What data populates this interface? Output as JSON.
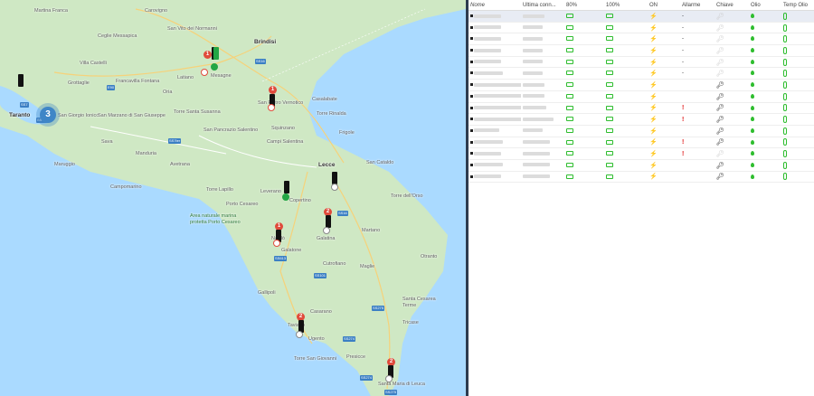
{
  "map": {
    "labels": [
      {
        "text": "Martina Franca",
        "type": ""
      },
      {
        "text": "Carovigno",
        "type": ""
      },
      {
        "text": "Brindisi",
        "type": "city"
      },
      {
        "text": "Ceglie Messapica",
        "type": ""
      },
      {
        "text": "San Vito dei Normanni",
        "type": ""
      },
      {
        "text": "Mesagne",
        "type": ""
      },
      {
        "text": "Villa Castelli",
        "type": ""
      },
      {
        "text": "Grottaglie",
        "type": ""
      },
      {
        "text": "Francavilla Fontana",
        "type": ""
      },
      {
        "text": "Latiano",
        "type": ""
      },
      {
        "text": "Oria",
        "type": ""
      },
      {
        "text": "Taranto",
        "type": "city"
      },
      {
        "text": "San Giorgio Ionico",
        "type": ""
      },
      {
        "text": "San Marzano di San Giuseppe",
        "type": ""
      },
      {
        "text": "Torre Santa Susanna",
        "type": ""
      },
      {
        "text": "San Pietro Vernotico",
        "type": ""
      },
      {
        "text": "Casalabate",
        "type": ""
      },
      {
        "text": "Torre Rinalda",
        "type": ""
      },
      {
        "text": "Sava",
        "type": ""
      },
      {
        "text": "Manduria",
        "type": ""
      },
      {
        "text": "San Pancrazio Salentino",
        "type": ""
      },
      {
        "text": "Squinzano",
        "type": ""
      },
      {
        "text": "Campi Salentina",
        "type": ""
      },
      {
        "text": "Frigole",
        "type": ""
      },
      {
        "text": "Maruggio",
        "type": ""
      },
      {
        "text": "Avetrana",
        "type": ""
      },
      {
        "text": "Lecce",
        "type": "city"
      },
      {
        "text": "San Cataldo",
        "type": ""
      },
      {
        "text": "Campomarino",
        "type": ""
      },
      {
        "text": "Torre Lapillo",
        "type": ""
      },
      {
        "text": "Leverano",
        "type": ""
      },
      {
        "text": "Copertino",
        "type": ""
      },
      {
        "text": "Torre dell'Orso",
        "type": ""
      },
      {
        "text": "Porto Cesareo",
        "type": ""
      },
      {
        "text": "Area naturale marina protetta Porto Cesareo",
        "type": "park"
      },
      {
        "text": "Nardò",
        "type": ""
      },
      {
        "text": "Galatina",
        "type": ""
      },
      {
        "text": "Martano",
        "type": ""
      },
      {
        "text": "Otranto",
        "type": ""
      },
      {
        "text": "Galatone",
        "type": ""
      },
      {
        "text": "Cutrofiano",
        "type": ""
      },
      {
        "text": "Maglie",
        "type": ""
      },
      {
        "text": "Gallipoli",
        "type": ""
      },
      {
        "text": "Santa Cesarea Terme",
        "type": ""
      },
      {
        "text": "Casarano",
        "type": ""
      },
      {
        "text": "Taviano",
        "type": ""
      },
      {
        "text": "Tricase",
        "type": ""
      },
      {
        "text": "Ugento",
        "type": ""
      },
      {
        "text": "Torre San Giovanni",
        "type": ""
      },
      {
        "text": "Presicce",
        "type": ""
      },
      {
        "text": "Santa Maria di Leuca",
        "type": ""
      }
    ],
    "shields": [
      "SS7",
      "E90",
      "SS7ter",
      "SS7ter",
      "SS16",
      "SS16",
      "SS101",
      "SS274",
      "SS274",
      "SS275",
      "SS275",
      "SS613"
    ],
    "cluster_count": "3",
    "badges": [
      "1",
      "1",
      "1",
      "1",
      "2",
      "2",
      "2"
    ]
  },
  "table": {
    "headers": [
      "Nome",
      "Ultima conn...",
      "80%",
      "100%",
      "ON",
      "Allarme",
      "Chiave",
      "Olio",
      "Temp Olio"
    ],
    "rows": [
      {
        "on": "bolt",
        "alarm": "dash",
        "key": "grey"
      },
      {
        "on": "bolt",
        "alarm": "dash",
        "key": "grey"
      },
      {
        "on": "bolt",
        "alarm": "dash",
        "key": "grey"
      },
      {
        "on": "bolt",
        "alarm": "dash",
        "key": "grey"
      },
      {
        "on": "bolt",
        "alarm": "dash",
        "key": "grey"
      },
      {
        "on": "bolt",
        "alarm": "dash",
        "key": "grey"
      },
      {
        "on": "bolt",
        "alarm": "",
        "key": "dark"
      },
      {
        "on": "bolt",
        "alarm": "",
        "key": "dark"
      },
      {
        "on": "bolt",
        "alarm": "alarm",
        "key": "dark"
      },
      {
        "on": "grey",
        "alarm": "alarm",
        "key": "dark"
      },
      {
        "on": "grey",
        "alarm": "",
        "key": "dark"
      },
      {
        "on": "bolt",
        "alarm": "alarm",
        "key": "dark"
      },
      {
        "on": "grey",
        "alarm": "alarm",
        "key": "grey"
      },
      {
        "on": "grey",
        "alarm": "",
        "key": "dark"
      },
      {
        "on": "grey",
        "alarm": "",
        "key": "dark"
      }
    ],
    "alarm_glyph": "!",
    "dash_glyph": "-"
  }
}
